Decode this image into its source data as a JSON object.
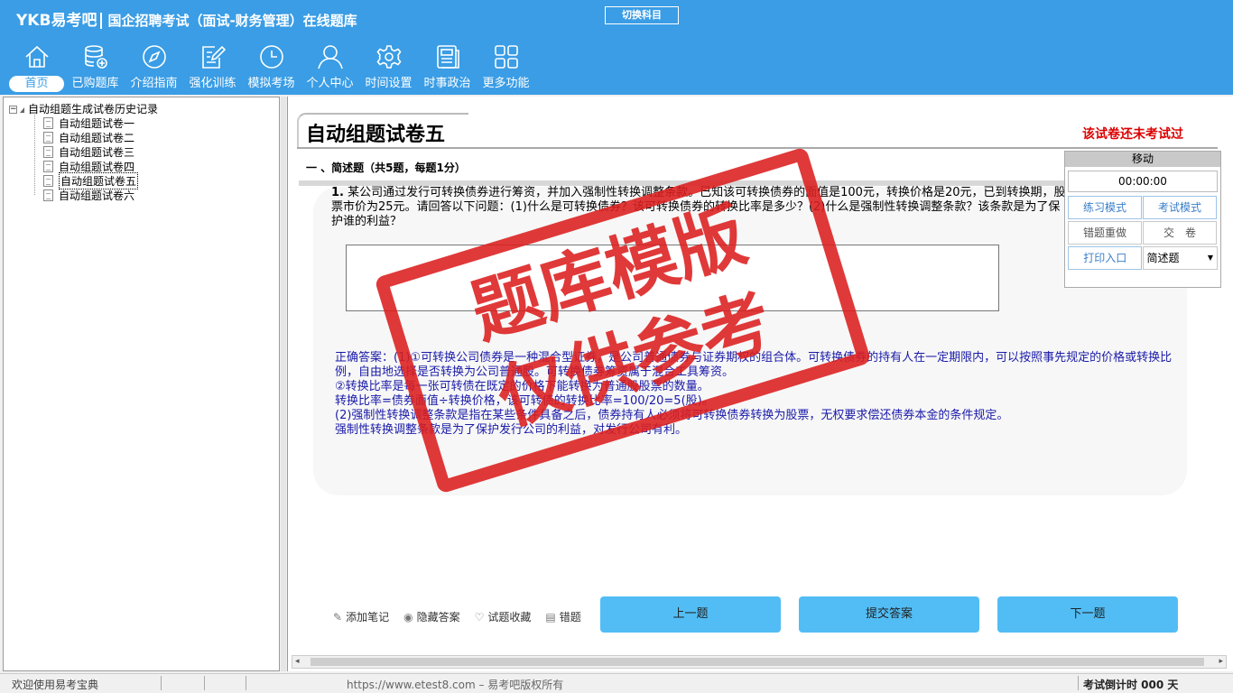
{
  "app": {
    "brand": "YKB易考吧",
    "title": "国企招聘考试（面试-财务管理）在线题库",
    "switch_label": "切换科目"
  },
  "nav": [
    {
      "label": "首页",
      "icon": "home-icon"
    },
    {
      "label": "已购题库",
      "icon": "database-icon"
    },
    {
      "label": "介绍指南",
      "icon": "compass-icon"
    },
    {
      "label": "强化训练",
      "icon": "edit-icon"
    },
    {
      "label": "模拟考场",
      "icon": "clock-icon"
    },
    {
      "label": "个人中心",
      "icon": "user-icon"
    },
    {
      "label": "时间设置",
      "icon": "gear-icon"
    },
    {
      "label": "时事政治",
      "icon": "news-icon"
    },
    {
      "label": "更多功能",
      "icon": "grid-icon"
    }
  ],
  "tree": {
    "root": "自动组题生成试卷历史记录",
    "items": [
      "自动组题试卷一",
      "自动组题试卷二",
      "自动组题试卷三",
      "自动组题试卷四",
      "自动组题试卷五",
      "自动组题试卷六"
    ],
    "selected_index": 4
  },
  "paper": {
    "title": "自动组题试卷五",
    "status": "该试卷还未考试过",
    "section": "一 、简述题（共5题，每题1分）"
  },
  "question": {
    "number": "1.",
    "text": "某公司通过发行可转换债券进行筹资，并加入强制性转换调整条款。已知该可转换债券的面值是100元，转换价格是20元，已到转换期，股票市价为25元。请回答以下问题：(1)什么是可转换债券？该可转换债券的转换比率是多少？(2)什么是强制性转换调整条款？该条款是为了保护谁的利益？",
    "answer_lines": [
      "正确答案：(1)①可转换公司债券是一种混合型证券，是公司普通债券与证券期权的组合体。可转换债券的持有人在一定期限内，可以按照事先规定的价格或转换比例，自由地选择是否转换为公司普通股。可转换债券筹资属于混合工具筹资。",
      "②转换比率是每一张可转债在既定的价格下能转换为普通股股票的数量。",
      "转换比率=债券面值÷转换价格，该可转债的转换比率=100/20=5(股)。",
      "(2)强制性转换调整条款是指在某些条件具备之后，债券持有人必须将可转换债券转换为股票，无权要求偿还债券本金的条件规定。",
      "强制性转换调整条款是为了保护发行公司的利益，对发行公司有利。"
    ]
  },
  "panel": {
    "move": "移动",
    "timer": "00:00:00",
    "practice": "练习模式",
    "exam": "考试模式",
    "redo": "错题重做",
    "submit_paper": "交　卷",
    "print": "打印入口",
    "type_select": "简述题"
  },
  "tools": [
    {
      "label": "添加笔记",
      "icon": "pencil-icon"
    },
    {
      "label": "隐藏答案",
      "icon": "eye-icon"
    },
    {
      "label": "试题收藏",
      "icon": "heart-icon"
    },
    {
      "label": "错题",
      "icon": "book-icon"
    }
  ],
  "buttons": {
    "prev": "上一题",
    "submit": "提交答案",
    "next": "下一题"
  },
  "stamp": {
    "line1": "题库模版",
    "line2": "仅供参考"
  },
  "status": {
    "welcome": "欢迎使用易考宝典",
    "url": "https://www.etest8.com – 易考吧版权所有",
    "countdown": "考试倒计时 000 天"
  }
}
